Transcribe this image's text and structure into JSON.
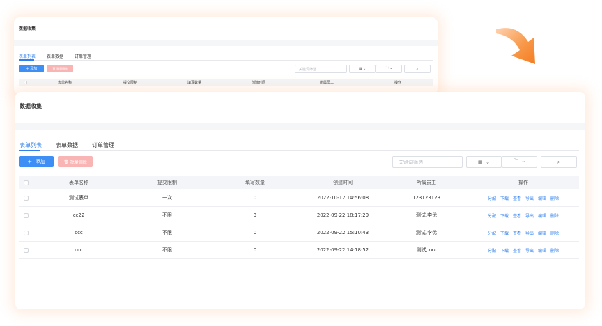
{
  "page_title": "数据收集",
  "tabs": [
    "表单列表",
    "表单数据",
    "订单管理"
  ],
  "actions": {
    "add_label": "添加",
    "batch_delete_label": "批量删除"
  },
  "search": {
    "placeholder": "关键词筛选"
  },
  "columns": [
    "表单名称",
    "提交限制",
    "填写数量",
    "创建时间",
    "所属员工",
    "操作"
  ],
  "row_actions": [
    "分配",
    "下载",
    "查看",
    "导出",
    "编辑",
    "删除"
  ],
  "rows": [
    {
      "name": "测试表单",
      "limit": "一次",
      "count": "0",
      "created": "2022-10-12 14:56:08",
      "staff": "123123123"
    },
    {
      "name": "cc22",
      "limit": "不限",
      "count": "3",
      "created": "2022-09-22 18:17:29",
      "staff": "测试,李优"
    },
    {
      "name": "ccc",
      "limit": "不限",
      "count": "0",
      "created": "2022-09-22 15:10:43",
      "staff": "测试,李优"
    },
    {
      "name": "ccc",
      "limit": "不限",
      "count": "0",
      "created": "2022-09-22 14:18:52",
      "staff": "测试,xxx"
    }
  ],
  "icons": {
    "add": "plus-icon",
    "delete": "trash-icon",
    "view": "grid-icon",
    "folder": "folder-icon",
    "search": "search-icon",
    "caret": "chevron-down-icon",
    "transition": "curved-arrow-icon"
  },
  "colors": {
    "accent": "#2f80ed",
    "primary_button": "#3d8ef5",
    "danger_button": "#f9b4b4",
    "arrow": "#f47c20",
    "glow": "#ffd7bd"
  }
}
